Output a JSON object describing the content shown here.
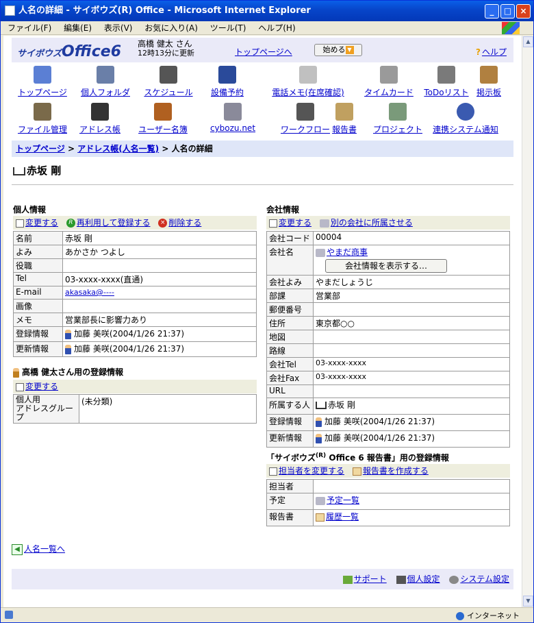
{
  "window": {
    "title": "人名の詳細 - サイボウズ(R) Office - Microsoft Internet Explorer"
  },
  "menu": [
    "ファイル(F)",
    "編集(E)",
    "表示(V)",
    "お気に入り(A)",
    "ツール(T)",
    "ヘルプ(H)"
  ],
  "header": {
    "logo_small": "サイボウズ",
    "logo_big": "Office6",
    "user_name": "高橋 健太 さん",
    "updated": "12時13分に更新",
    "top_link": "トップページへ",
    "start": "始める",
    "help": "ヘルプ"
  },
  "apps": [
    {
      "label": "トップページ",
      "icon": "top-page-icon",
      "color": "#5b7fd4"
    },
    {
      "label": "個人フォルダ",
      "icon": "personal-folder-icon",
      "color": "#6a7fa8"
    },
    {
      "label": "スケジュール",
      "icon": "schedule-icon",
      "color": "#555555"
    },
    {
      "label": "設備予約",
      "icon": "facility-icon",
      "color": "#2a4a9a"
    },
    {
      "label": "電話メモ(在席確認)",
      "icon": "phone-memo-icon",
      "color": "#c0c0c0"
    },
    {
      "label": "タイムカード",
      "icon": "timecard-icon",
      "color": "#9a9a9a"
    },
    {
      "label": "ToDoリスト",
      "icon": "todo-icon",
      "color": "#7a7a7a"
    },
    {
      "label": "掲示板",
      "icon": "bulletin-icon",
      "color": "#b08040"
    },
    {
      "label": "ファイル管理",
      "icon": "file-manage-icon",
      "color": "#7a6a4a"
    },
    {
      "label": "アドレス帳",
      "icon": "address-book-icon",
      "color": "#333333"
    },
    {
      "label": "ユーザー名簿",
      "icon": "user-list-icon",
      "color": "#b06020"
    },
    {
      "label": "cybozu.net",
      "icon": "cybozu-net-icon",
      "color": "#8a8a9a"
    },
    {
      "label": "ワークフロー",
      "icon": "workflow-icon",
      "color": "#555555"
    },
    {
      "label": "報告書",
      "icon": "report-icon",
      "color": "#c0a060"
    },
    {
      "label": "プロジェクト",
      "icon": "project-icon",
      "color": "#7a9a7a"
    },
    {
      "label": "連携システム通知",
      "icon": "notification-icon",
      "color": "#3a5ab0"
    }
  ],
  "breadcrumb": {
    "top": "トップページ",
    "sep1": " > ",
    "address": "アドレス帳(人名一覧)",
    "sep2": " > ",
    "current": "人名の詳細"
  },
  "page_title": "赤坂 剛",
  "personal": {
    "heading": "個人情報",
    "actions": {
      "edit": "変更する",
      "reuse": "再利用して登録する",
      "delete": "削除する"
    },
    "rows": [
      {
        "k": "名前",
        "v": "赤坂 剛"
      },
      {
        "k": "よみ",
        "v": "あかさか つよし"
      },
      {
        "k": "役職",
        "v": ""
      },
      {
        "k": "Tel",
        "v": "03-xxxx-xxxx(直通)"
      },
      {
        "k": "E-mail",
        "v": "akasaka@----"
      },
      {
        "k": "画像",
        "v": ""
      },
      {
        "k": "メモ",
        "v": "営業部長に影響力あり"
      },
      {
        "k": "登録情報",
        "v": "加藤 美咲(2004/1/26 21:37)"
      },
      {
        "k": "更新情報",
        "v": "加藤 美咲(2004/1/26 21:37)"
      }
    ]
  },
  "user_reg": {
    "heading": "高橋 健太さん用の登録情報",
    "edit": "変更する",
    "key": "個人用\nアドレスグループ",
    "value": "(未分類)"
  },
  "company": {
    "heading": "会社情報",
    "actions": {
      "edit": "変更する",
      "move": "別の会社に所属させる"
    },
    "show_button": "会社情報を表示する…",
    "rows": [
      {
        "k": "会社コード",
        "v": "00004"
      },
      {
        "k": "会社名",
        "v": "やまだ商事"
      },
      {
        "k": "会社よみ",
        "v": "やまだしょうじ"
      },
      {
        "k": "部課",
        "v": "営業部"
      },
      {
        "k": "郵便番号",
        "v": ""
      },
      {
        "k": "住所",
        "v": "東京都○○"
      },
      {
        "k": "地図",
        "v": ""
      },
      {
        "k": "路線",
        "v": ""
      },
      {
        "k": "会社Tel",
        "v": "03-xxxx-xxxx"
      },
      {
        "k": "会社Fax",
        "v": "03-xxxx-xxxx"
      },
      {
        "k": "URL",
        "v": ""
      },
      {
        "k": "所属する人",
        "v": "赤坂 剛"
      },
      {
        "k": "登録情報",
        "v": "加藤 美咲(2004/1/26 21:37)"
      },
      {
        "k": "更新情報",
        "v": "加藤 美咲(2004/1/26 21:37)"
      }
    ]
  },
  "report": {
    "heading_pre": "「サイボウズ",
    "heading_sup": "(R)",
    "heading_post": " Office 6 報告書」用の登録情報",
    "actions": {
      "change_owner": "担当者を変更する",
      "create": "報告書を作成する"
    },
    "rows": [
      {
        "k": "担当者",
        "v": ""
      },
      {
        "k": "予定",
        "v": "予定一覧"
      },
      {
        "k": "報告書",
        "v": "履歴一覧"
      }
    ]
  },
  "back_link": "人名一覧へ",
  "footer": {
    "support": "サポート",
    "personal_settings": "個人設定",
    "system_settings": "システム設定"
  },
  "status": {
    "zone": "インターネット"
  }
}
